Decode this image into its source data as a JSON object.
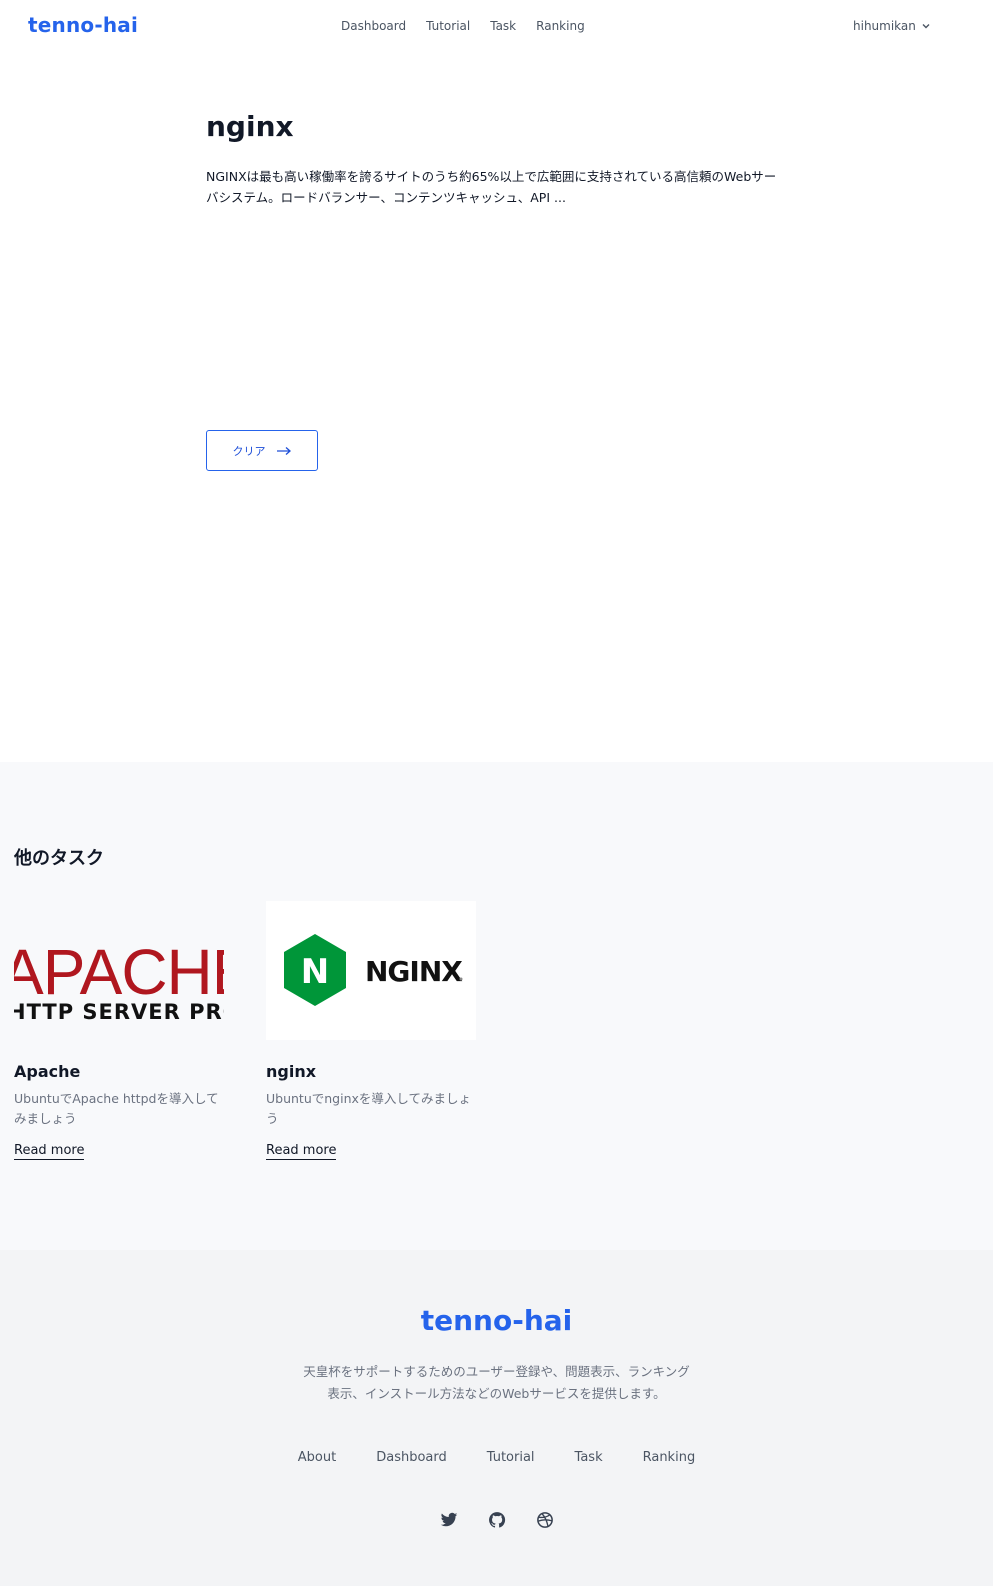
{
  "header": {
    "brand": "tenno-hai",
    "nav": [
      "Dashboard",
      "Tutorial",
      "Task",
      "Ranking"
    ],
    "user": "hihumikan"
  },
  "task": {
    "title": "nginx",
    "description": "NGINXは最も高い稼働率を誇るサイトのうち約65%以上で広範囲に支持されている高信頼のWebサーバシステム。ロードバランサー、コンテンツキャッシュ、API ...",
    "clear_label": "クリア"
  },
  "others": {
    "title": "他のタスク",
    "cards": [
      {
        "image_line1": "APACHE",
        "image_line2": "HTTP SERVER PROJECT",
        "title": "Apache",
        "description": "UbuntuでApache httpdを導入してみましょう",
        "link": "Read more"
      },
      {
        "image_text": "NGINX",
        "image_letter": "N",
        "title": "nginx",
        "description": "Ubuntuでnginxを導入してみましょう",
        "link": "Read more"
      }
    ]
  },
  "footer": {
    "brand": "tenno-hai",
    "description": "天皇杯をサポートするためのユーザー登録や、問題表示、ランキング表示、インストール方法などのWebサービスを提供します。",
    "nav": [
      "About",
      "Dashboard",
      "Tutorial",
      "Task",
      "Ranking"
    ],
    "social": [
      "twitter-icon",
      "github-icon",
      "dribbble-icon"
    ]
  },
  "colors": {
    "accent": "#2563eb",
    "apache_red": "#b0171f",
    "nginx_green": "#009639"
  }
}
